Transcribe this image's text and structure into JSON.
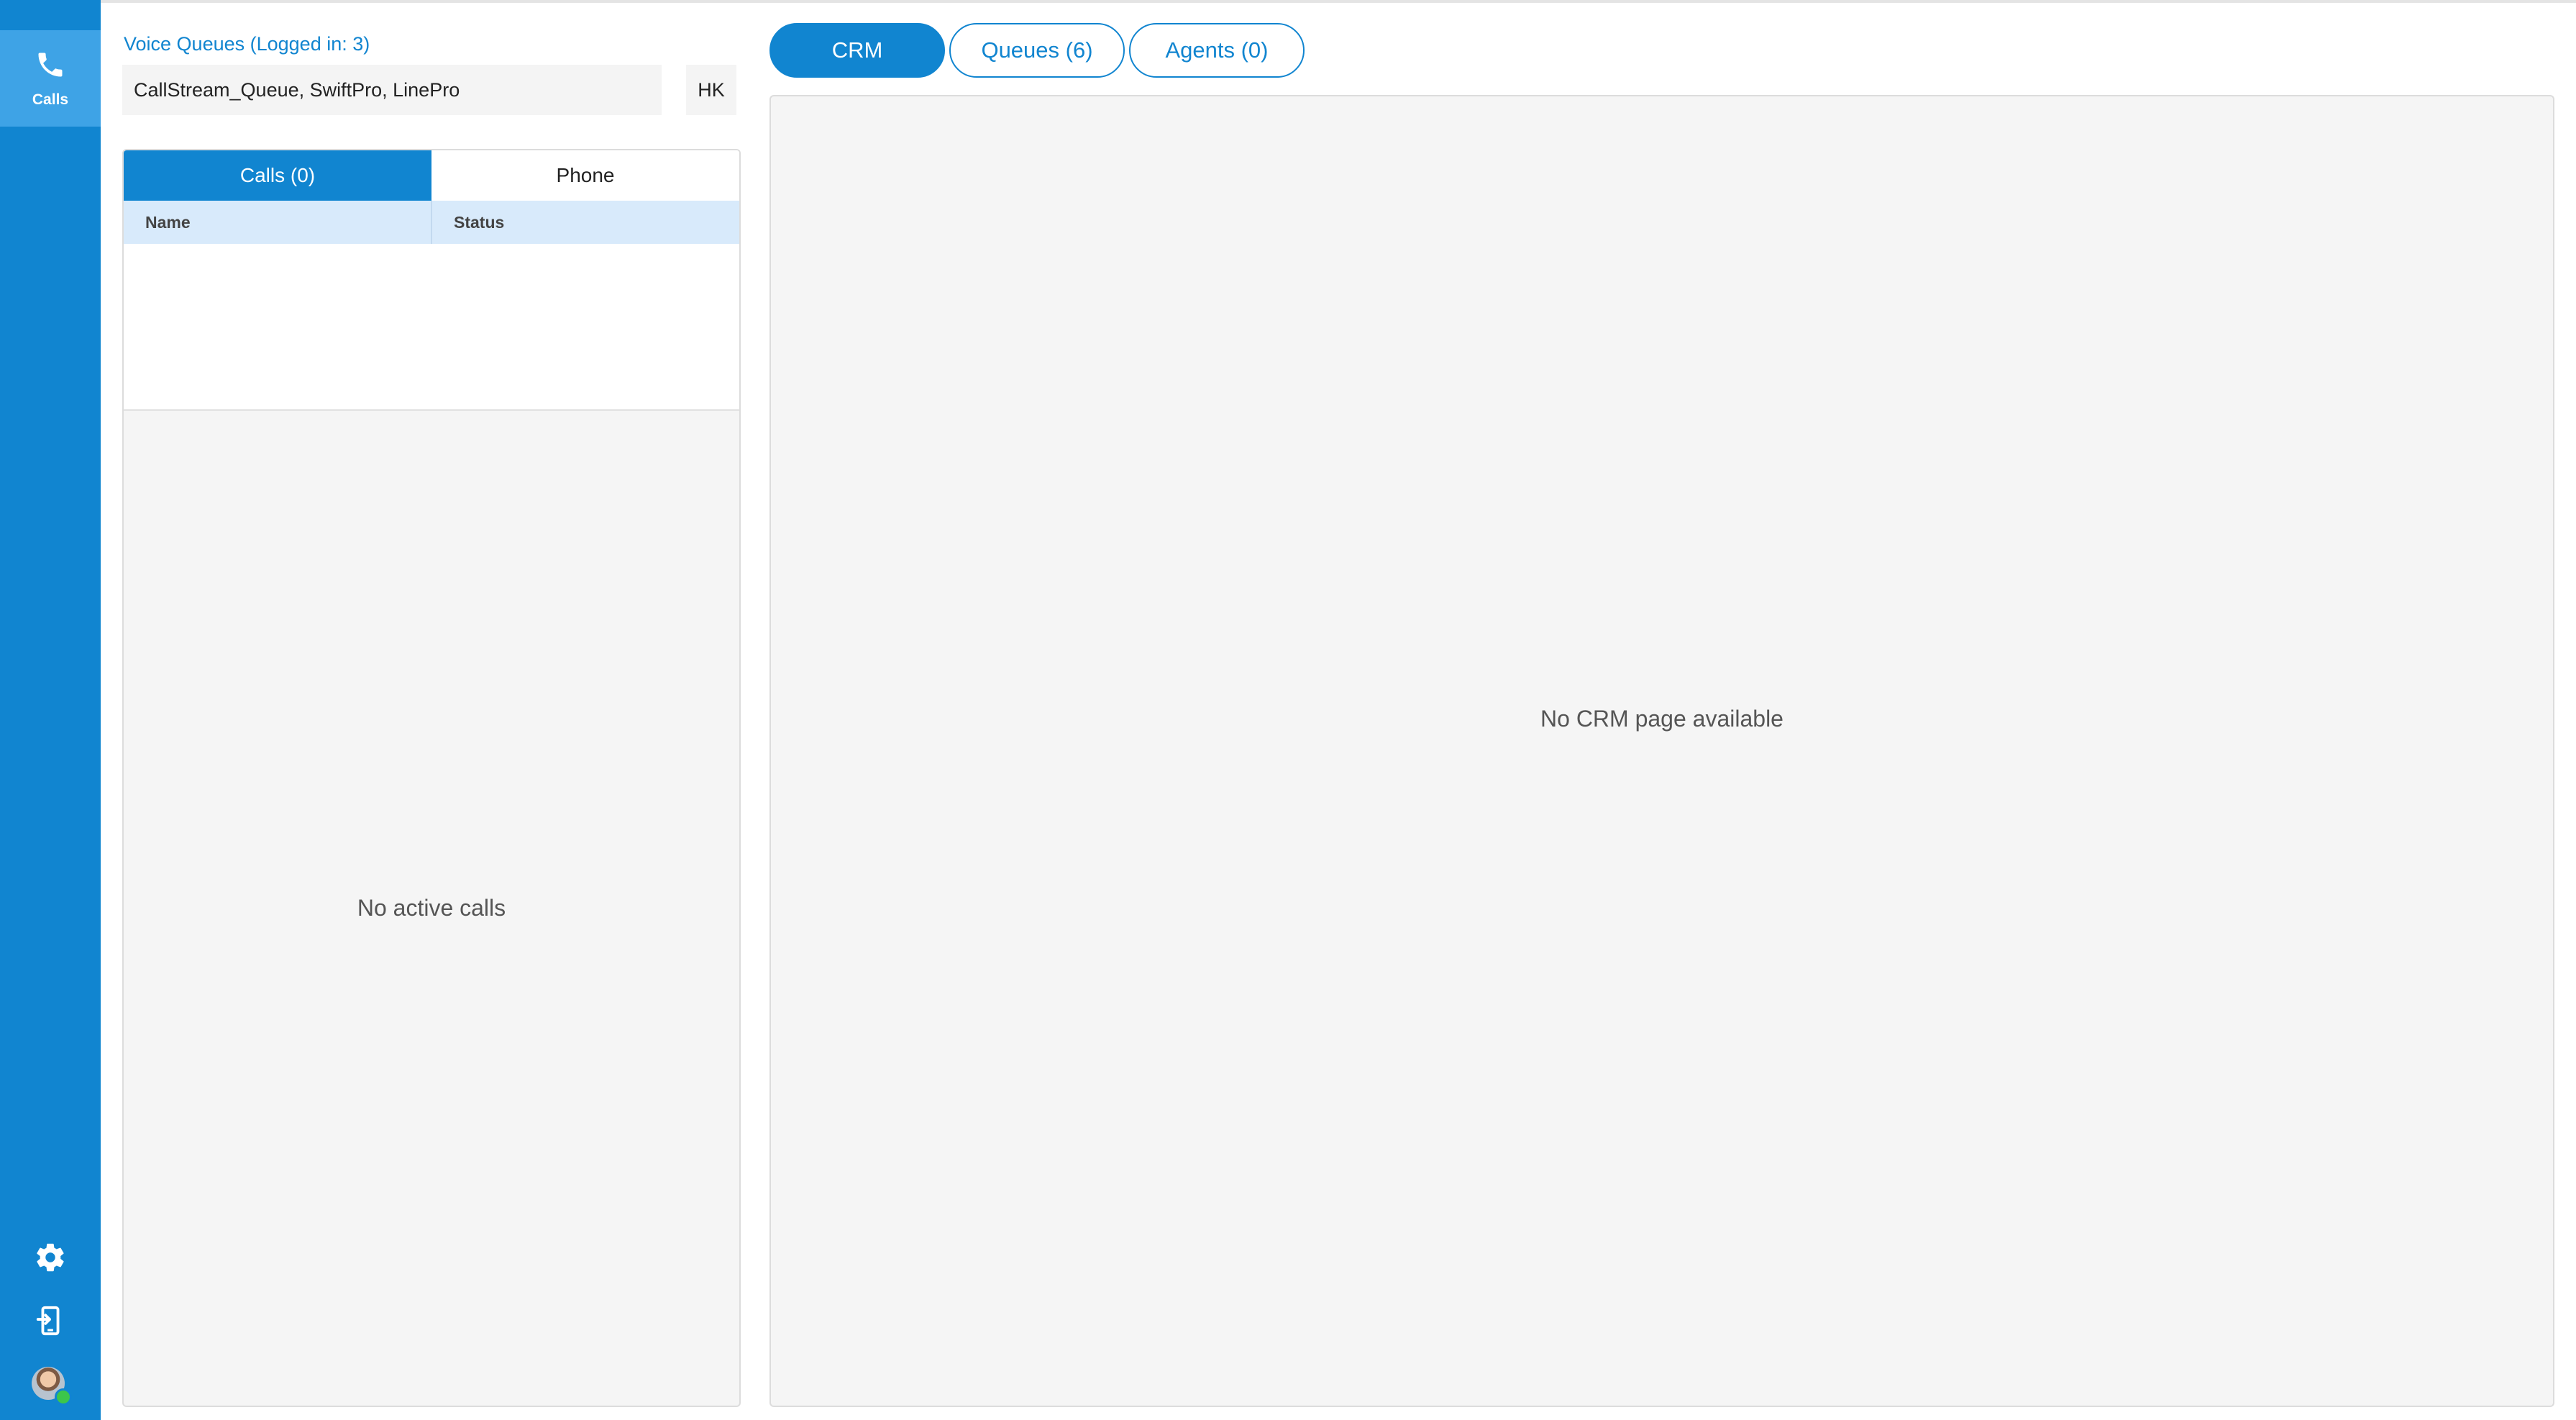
{
  "rail": {
    "calls_label": "Calls",
    "icons": {
      "calls": "phone-icon",
      "settings": "gear-icon",
      "logout": "exit-device-icon",
      "avatar": "user-avatar"
    },
    "presence_color": "#3cc64a"
  },
  "voice_queues": {
    "title": "Voice Queues (Logged in: 3)",
    "queues_value": "CallStream_Queue, SwiftPro, LinePro",
    "region": "HK"
  },
  "calls_panel": {
    "tabs": [
      {
        "label": "Calls (0)",
        "active": true
      },
      {
        "label": "Phone",
        "active": false
      }
    ],
    "columns": [
      "Name",
      "Status"
    ],
    "rows": [],
    "empty_message": "No active calls"
  },
  "main_tabs": [
    {
      "label": "CRM",
      "active": true
    },
    {
      "label": "Queues (6)",
      "active": false
    },
    {
      "label": "Agents (0)",
      "active": false
    }
  ],
  "crm": {
    "empty_message": "No CRM page available"
  },
  "colors": {
    "brand": "#1185d0",
    "brand_light": "#3ea3e6",
    "table_header": "#d8eafb",
    "panel_bg": "#f5f5f5"
  }
}
